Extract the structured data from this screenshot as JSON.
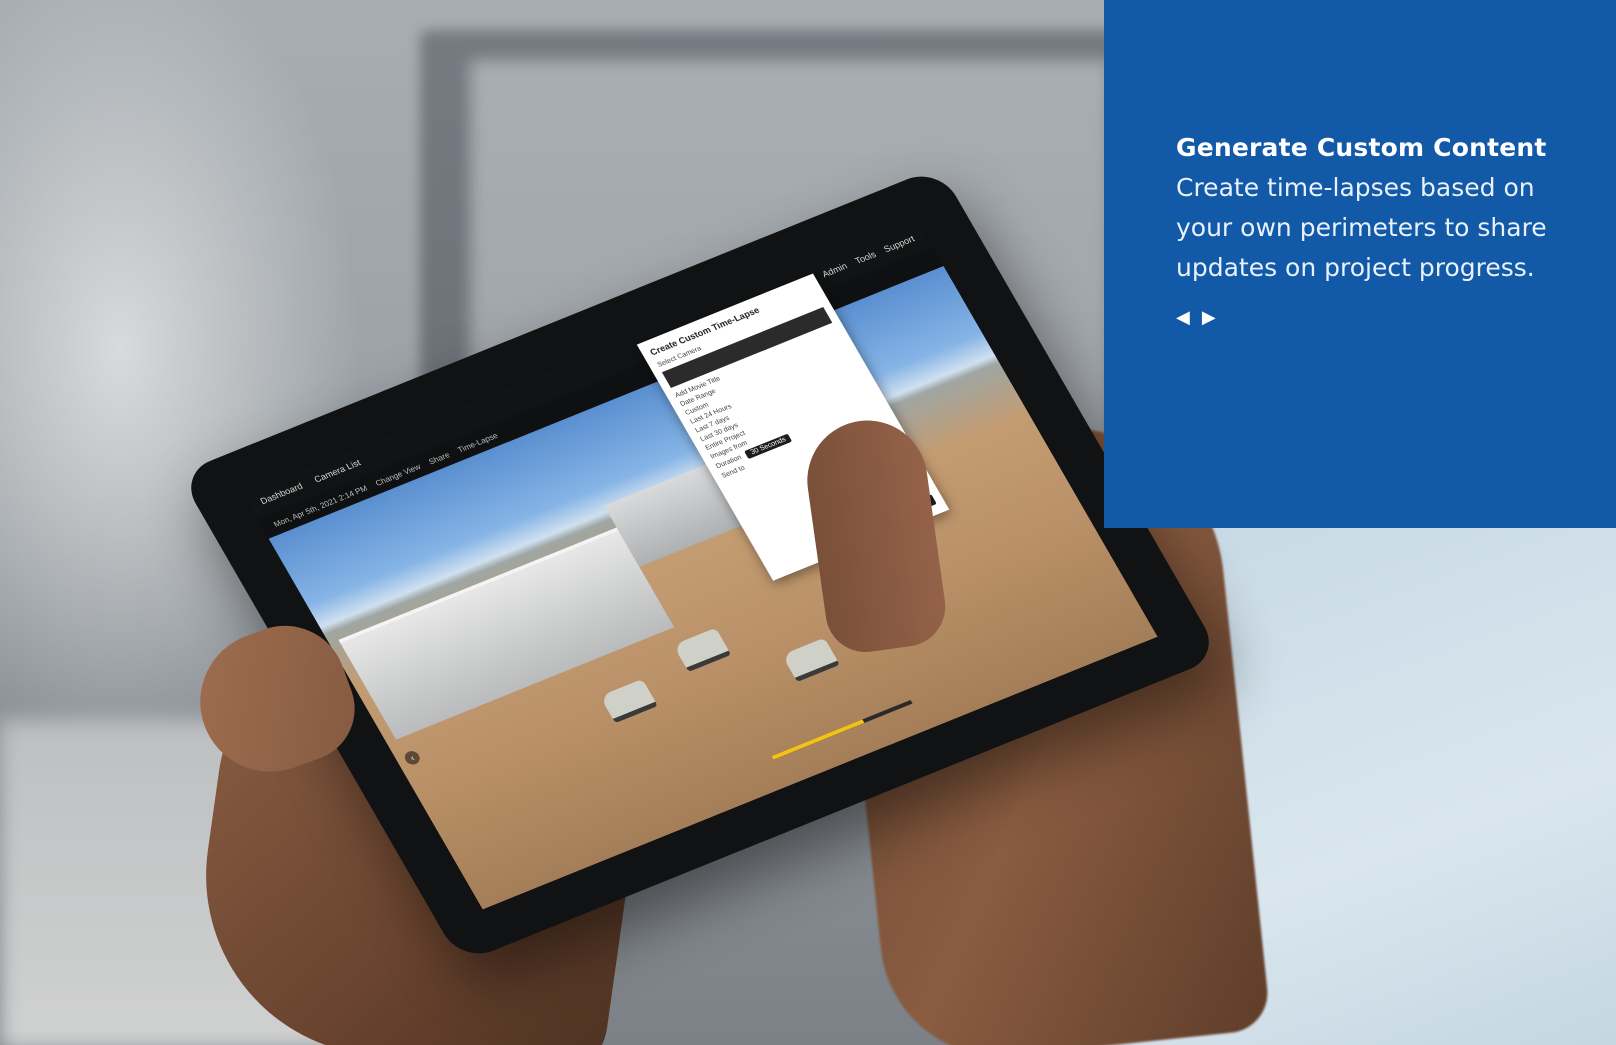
{
  "feature": {
    "title": "Generate Custom Content",
    "description": "Create time-lapses based on your own perimeters to share updates on project progress.",
    "nav": {
      "prev_icon": "◀",
      "next_icon": "▶"
    }
  },
  "tablet_app": {
    "topbar": {
      "dashboard": "Dashboard",
      "camera_list": "Camera List",
      "admin": "Admin",
      "tools": "Tools",
      "support": "Support"
    },
    "subbar": {
      "date": "Mon, Apr 5th, 2021 2:14 PM",
      "change_view": "Change View",
      "share": "Share",
      "time_lapse": "Time-Lapse"
    },
    "dialog": {
      "title": "Create Custom Time-Lapse",
      "select_camera": "Select Camera",
      "add_movie_title": "Add Movie Title",
      "date_range": "Date Range",
      "options": [
        "Custom",
        "Last 24 Hours",
        "Last 7 days",
        "Last 30 days",
        "Entire Project"
      ],
      "images_from": "Images from",
      "duration": "Duration",
      "duration_value": "30 Seconds",
      "send_to": "Send to",
      "send_button": "Send"
    },
    "progress_fraction": 0.65
  },
  "colors": {
    "panel_bg": "#1259a8",
    "panel_text": "#ffffff"
  }
}
